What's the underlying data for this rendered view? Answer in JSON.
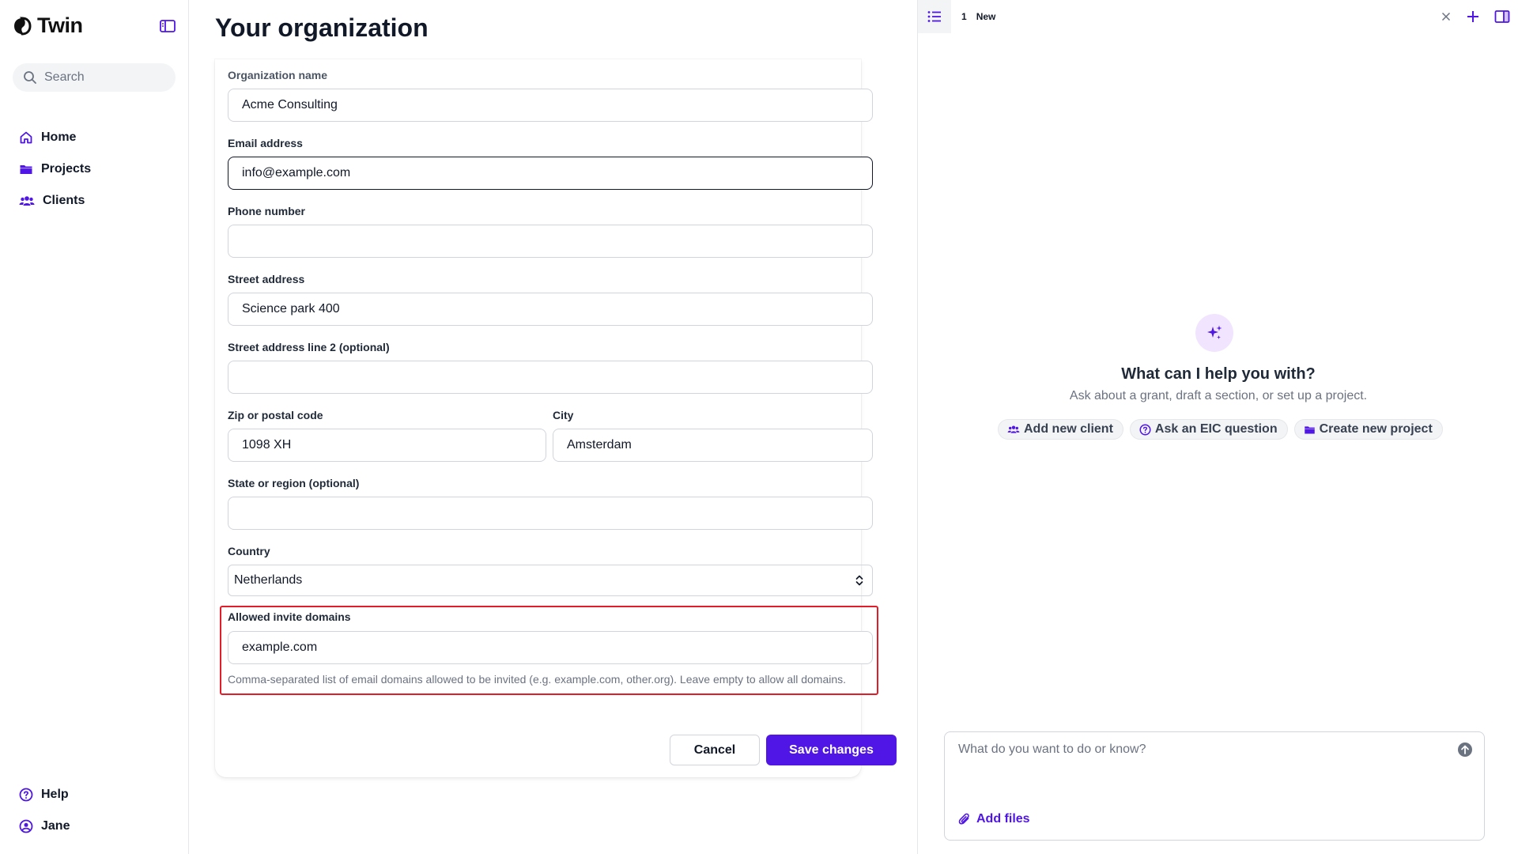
{
  "app": {
    "brand_name": "Twin",
    "accent_color": "#4f16e6"
  },
  "sidebar": {
    "search_placeholder": "Search",
    "items": [
      {
        "label": "Home",
        "icon": "home-icon"
      },
      {
        "label": "Projects",
        "icon": "folder-icon"
      },
      {
        "label": "Clients",
        "icon": "users-icon"
      }
    ],
    "bottom_items": [
      {
        "label": "Help",
        "icon": "help-circle-icon"
      },
      {
        "label": "Jane",
        "icon": "user-circle-icon"
      }
    ]
  },
  "page": {
    "title": "Your organization"
  },
  "form": {
    "org_name": {
      "label": "Organization name",
      "value": "Acme Consulting"
    },
    "email": {
      "label": "Email address",
      "value": "info@example.com"
    },
    "phone": {
      "label": "Phone number",
      "value": ""
    },
    "street": {
      "label": "Street address",
      "value": "Science park 400"
    },
    "street2": {
      "label": "Street address line 2 (optional)",
      "value": ""
    },
    "zip": {
      "label": "Zip or postal code",
      "value": "1098 XH"
    },
    "city": {
      "label": "City",
      "value": "Amsterdam"
    },
    "state": {
      "label": "State or region (optional)",
      "value": ""
    },
    "country": {
      "label": "Country",
      "value": "Netherlands"
    },
    "domains": {
      "label": "Allowed invite domains",
      "value": "example.com",
      "help": "Comma-separated list of email domains allowed to be invited (e.g. example.com, other.org). Leave empty to allow all domains."
    },
    "cancel_label": "Cancel",
    "save_label": "Save changes"
  },
  "chat": {
    "tab_number": "1",
    "tab_label": "New",
    "title": "What can I help you with?",
    "subtitle": "Ask about a grant, draft a section, or set up a project.",
    "chips": [
      {
        "label": "Add new client",
        "icon": "users-icon"
      },
      {
        "label": "Ask an EIC question",
        "icon": "help-circle-icon"
      },
      {
        "label": "Create new project",
        "icon": "folder-icon"
      }
    ],
    "composer_placeholder": "What do you want to do or know?",
    "add_files_label": "Add files"
  }
}
